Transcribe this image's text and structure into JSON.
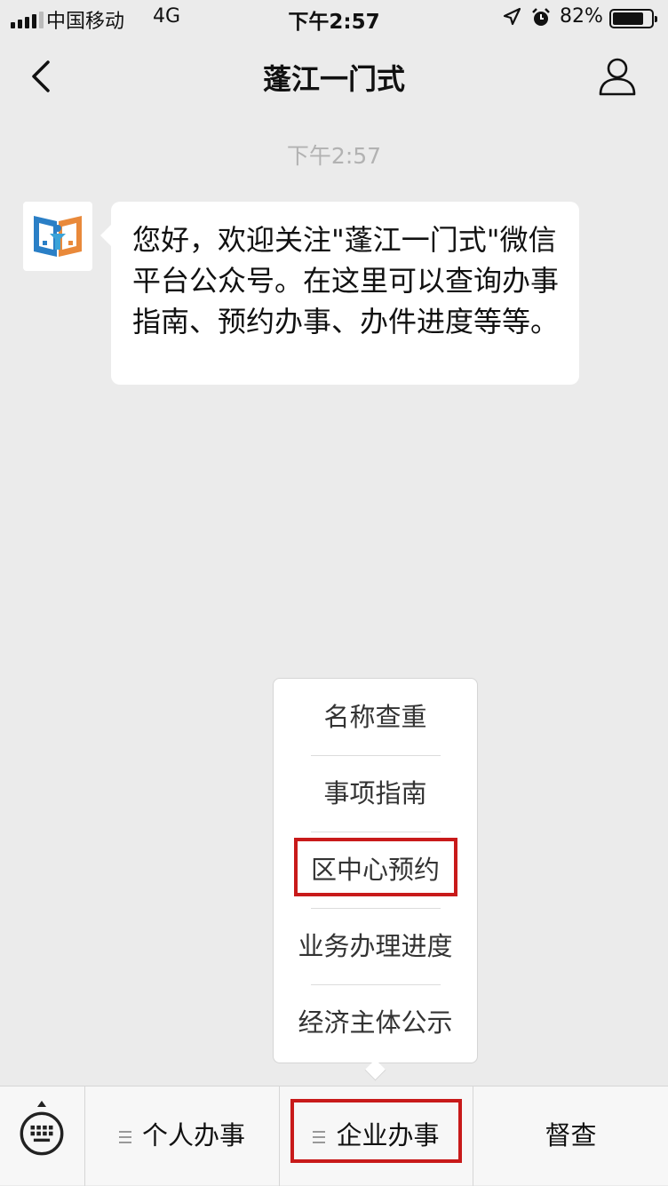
{
  "status_bar": {
    "carrier": "中国移动",
    "network": "4G",
    "time": "下午2:57",
    "battery_percent": "82%",
    "battery_level": 0.82
  },
  "navbar": {
    "title": "蓬江一门式",
    "back_icon": "chevron-left-icon",
    "profile_icon": "person-icon"
  },
  "chat": {
    "timestamp": "下午2:57",
    "message": "您好，欢迎关注\"蓬江一门式\"微信平台公众号。在这里可以查询办事指南、预约办事、办件进度等等。"
  },
  "popup_menu": {
    "items": [
      {
        "label": "名称查重"
      },
      {
        "label": "事项指南"
      },
      {
        "label": "区中心预约"
      },
      {
        "label": "业务办理进度"
      },
      {
        "label": "经济主体公示"
      }
    ]
  },
  "bottom_menu": {
    "keyboard_icon": "keyboard-icon",
    "items": [
      {
        "label": "个人办事"
      },
      {
        "label": "企业办事"
      },
      {
        "label": "督查"
      }
    ]
  },
  "colors": {
    "background": "#ebebeb",
    "highlight": "#c81a1a"
  }
}
